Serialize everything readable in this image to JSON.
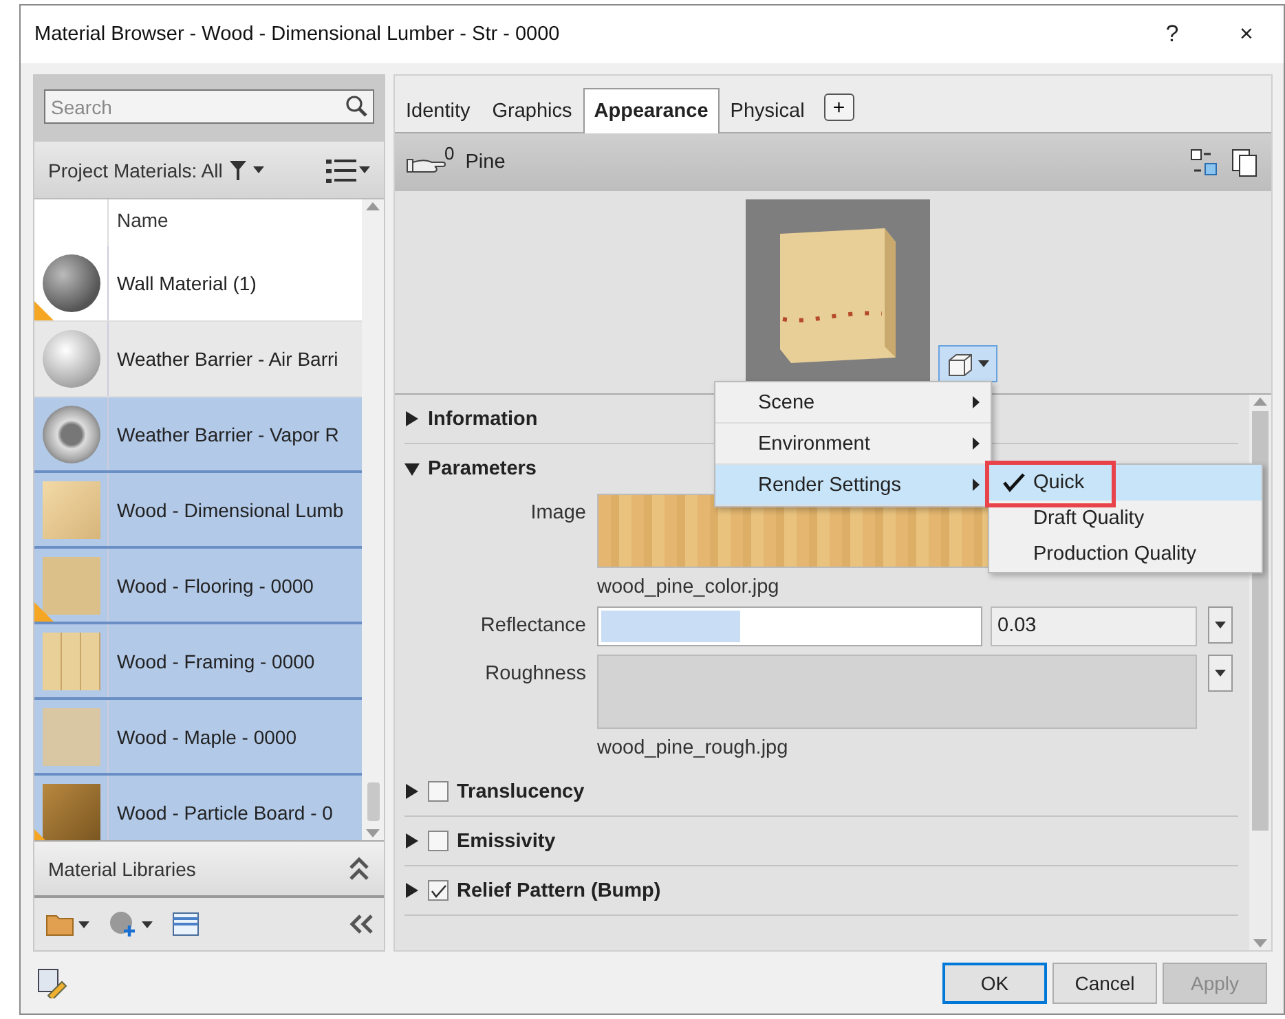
{
  "window": {
    "title": "Material Browser - Wood - Dimensional Lumber - Str - 0000",
    "help": "?",
    "close": "×"
  },
  "browser": {
    "search": {
      "placeholder": "Search"
    },
    "filter_label": "Project Materials: All",
    "column_name": "Name",
    "materials": [
      {
        "name": "Wall Material (1)",
        "kind": "sphere-dark",
        "warning": true,
        "selected": false
      },
      {
        "name": "Weather Barrier - Air Barri",
        "kind": "sphere-light",
        "warning": false,
        "selected": false
      },
      {
        "name": "Weather Barrier - Vapor R",
        "kind": "ring",
        "warning": false,
        "selected": true
      },
      {
        "name": "Wood - Dimensional Lumb",
        "kind": "cube-wood",
        "warning": false,
        "selected": true
      },
      {
        "name": "Wood - Flooring - 0000",
        "kind": "wood-flat",
        "warning": true,
        "selected": true
      },
      {
        "name": "Wood - Framing - 0000",
        "kind": "wood-planks",
        "warning": false,
        "selected": true
      },
      {
        "name": "Wood - Maple - 0000",
        "kind": "maple",
        "warning": false,
        "selected": true
      },
      {
        "name": "Wood - Particle Board - 0",
        "kind": "cube-particle",
        "warning": true,
        "selected": true
      }
    ],
    "libraries_label": "Material Libraries"
  },
  "editor": {
    "tabs": [
      {
        "label": "Identity",
        "selected": false
      },
      {
        "label": "Graphics",
        "selected": false
      },
      {
        "label": "Appearance",
        "selected": true
      },
      {
        "label": "Physical",
        "selected": false
      }
    ],
    "add_tab": "+",
    "asset_count": "0",
    "asset_name": "Pine",
    "sections": [
      {
        "kind": "header",
        "title": "Information",
        "expanded": false
      },
      {
        "kind": "header",
        "title": "Parameters",
        "expanded": true,
        "params": [
          {
            "kind": "wood-image",
            "label": "Image",
            "file": "wood_pine_color.jpg"
          },
          {
            "kind": "slider",
            "label": "Reflectance",
            "level": 0.37,
            "value": "0.03"
          },
          {
            "kind": "plain-image",
            "label": "Roughness",
            "file": "wood_pine_rough.jpg"
          }
        ]
      },
      {
        "kind": "checkable",
        "title": "Translucency",
        "expanded": false,
        "checked": false
      },
      {
        "kind": "checkable",
        "title": "Emissivity",
        "expanded": false,
        "checked": false
      },
      {
        "kind": "checkable",
        "title": "Relief Pattern (Bump)",
        "expanded": false,
        "checked": true
      }
    ]
  },
  "menu": {
    "items": [
      {
        "label": "Scene",
        "selected": false
      },
      {
        "label": "Environment",
        "selected": false
      },
      {
        "label": "Render Settings",
        "selected": true
      }
    ],
    "submenu": [
      {
        "label": "Quick",
        "checked": true,
        "selected": true
      },
      {
        "label": "Draft Quality",
        "checked": false,
        "selected": false
      },
      {
        "label": "Production Quality",
        "checked": false,
        "selected": false
      }
    ]
  },
  "buttons": [
    {
      "label": "OK",
      "disabled": false,
      "default": true
    },
    {
      "label": "Cancel",
      "disabled": false,
      "default": false
    },
    {
      "label": "Apply",
      "disabled": true,
      "default": false
    }
  ]
}
